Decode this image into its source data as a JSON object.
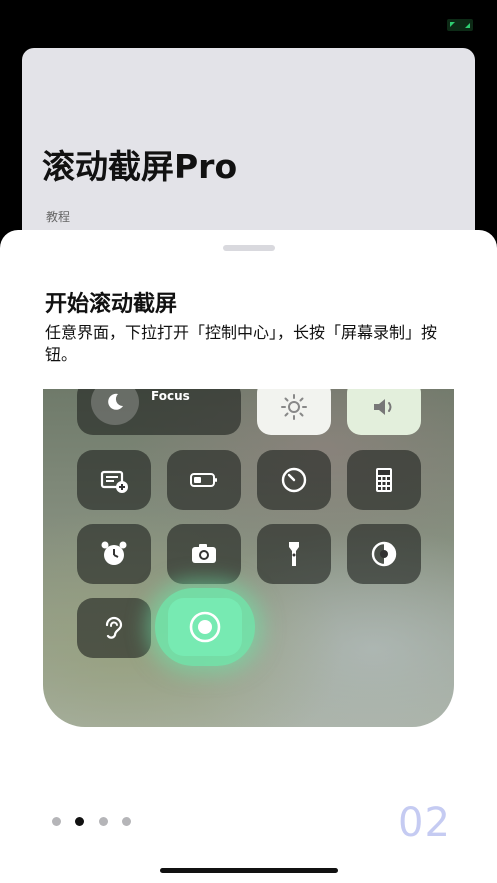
{
  "background_card": {
    "title": "滚动截屏Pro",
    "subtitle": "教程"
  },
  "sheet": {
    "title": "开始滚动截屏",
    "description": "任意界面，下拉打开「控制中心」，长按「屏幕录制」按钮。"
  },
  "illustration": {
    "focus_label": "Focus"
  },
  "pagination": {
    "total": 4,
    "active_index": 1,
    "page_number": "02"
  },
  "colors": {
    "accent_green": "#6ee6aa",
    "top_icon_green": "#2ecc71",
    "page_number": "#c5cbf2"
  },
  "icons": {
    "top_right": "fullscreen-toggle-icon",
    "tiles": [
      "add-card-icon",
      "battery-icon",
      "timer-icon",
      "calculator-icon",
      "alarm-icon",
      "camera-icon",
      "flashlight-icon",
      "dark-mode-icon",
      "hearing-icon",
      "screen-record-icon"
    ]
  }
}
